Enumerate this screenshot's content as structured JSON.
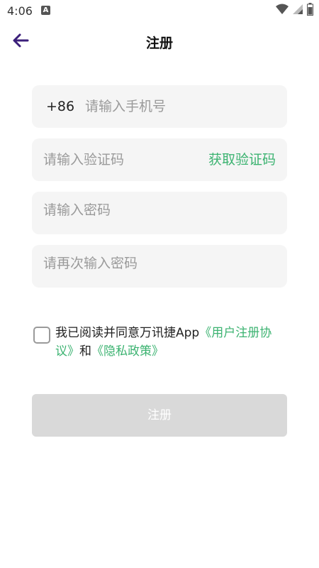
{
  "status_bar": {
    "time": "4:06",
    "notification_badge": "A",
    "icons": [
      "wifi-icon",
      "cell-signal-icon",
      "battery-icon"
    ]
  },
  "app_bar": {
    "back_icon": "arrow-left-icon",
    "title": "注册"
  },
  "form": {
    "phone": {
      "prefix": "+86",
      "placeholder": "请输入手机号"
    },
    "code": {
      "placeholder": "请输入验证码",
      "action_label": "获取验证码"
    },
    "password": {
      "placeholder": "请输入密码"
    },
    "confirm_password": {
      "placeholder": "请再次输入密码"
    }
  },
  "agreement": {
    "checked": false,
    "text_before": "我已阅读并同意万讯捷App",
    "user_agreement": "《用户注册协议》",
    "conjunction": "和",
    "privacy_policy": "《隐私政策》"
  },
  "submit": {
    "label": "注册"
  },
  "colors": {
    "accent": "#3cb371",
    "back_arrow": "#3b1f7a",
    "field_bg": "#f5f5f5",
    "button_disabled": "#d9d9d9"
  }
}
